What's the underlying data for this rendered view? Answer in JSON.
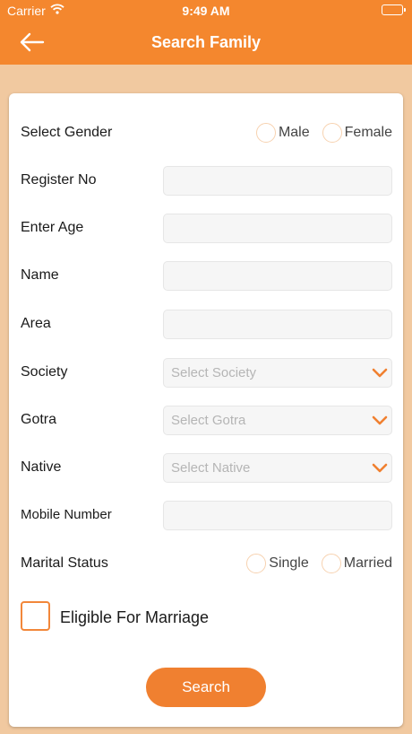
{
  "status_bar": {
    "carrier": "Carrier",
    "time": "9:49 AM"
  },
  "header": {
    "title": "Search Family"
  },
  "form": {
    "gender": {
      "label": "Select Gender",
      "options": [
        "Male",
        "Female"
      ]
    },
    "register_no": {
      "label": "Register No",
      "value": ""
    },
    "age": {
      "label": "Enter Age",
      "value": ""
    },
    "name": {
      "label": "Name",
      "value": ""
    },
    "area": {
      "label": "Area",
      "value": ""
    },
    "society": {
      "label": "Society",
      "placeholder": "Select Society"
    },
    "gotra": {
      "label": "Gotra",
      "placeholder": "Select Gotra"
    },
    "native": {
      "label": "Native",
      "placeholder": "Select Native"
    },
    "mobile": {
      "label": "Mobile Number",
      "value": ""
    },
    "marital_status": {
      "label": "Marital Status",
      "options": [
        "Single",
        "Married"
      ]
    },
    "eligible": {
      "label": "Eligible For Marriage",
      "checked": false
    },
    "search_label": "Search"
  },
  "colors": {
    "accent": "#f4872e",
    "background": "#f1c9a0",
    "button": "#f08030"
  }
}
